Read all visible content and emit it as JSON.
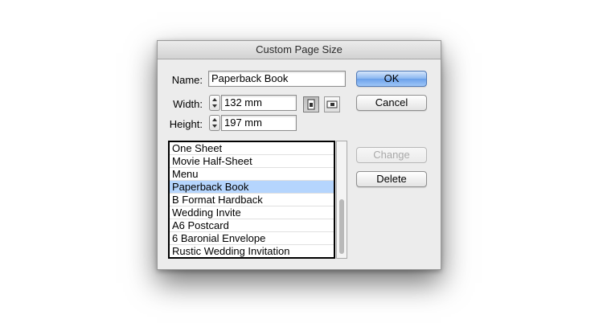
{
  "dialog": {
    "title": "Custom Page Size",
    "name_label": "Name:",
    "name_value": "Paperback Book",
    "width_label": "Width:",
    "width_value": "132 mm",
    "height_label": "Height:",
    "height_value": "197 mm",
    "orientation": {
      "portrait_icon": "portrait-orientation-icon",
      "landscape_icon": "landscape-orientation-icon",
      "selected": "portrait"
    },
    "buttons": {
      "ok": "OK",
      "cancel": "Cancel",
      "change": "Change",
      "delete": "Delete"
    },
    "presets": [
      "One Sheet",
      "Movie Half-Sheet",
      "Menu",
      "Paperback Book",
      "B Format Hardback",
      "Wedding Invite",
      "A6 Postcard",
      "6 Baronial Envelope",
      "Rustic Wedding Invitation"
    ],
    "selected_preset": "Paperback Book",
    "colors": {
      "selection": "#b5d5fd",
      "default_button": "#6aa0ea",
      "dialog_bg": "#ececec"
    }
  }
}
